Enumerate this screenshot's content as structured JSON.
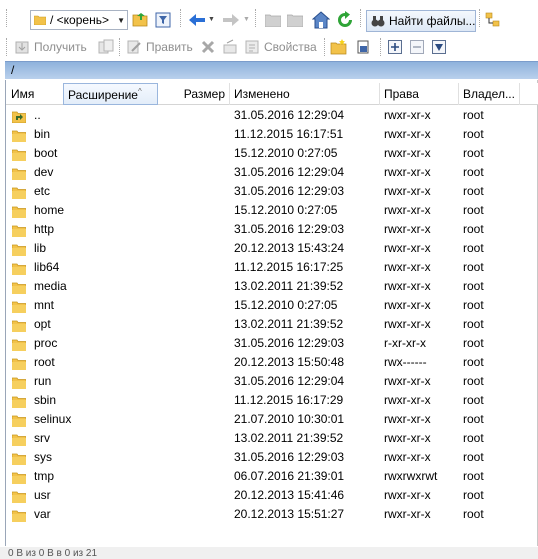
{
  "toolbar": {
    "path_combo_value": "/ <корень>",
    "find_files_label": "Найти файлы..."
  },
  "toolbar2": {
    "get_label": "Получить",
    "edit_label": "Править",
    "properties_label": "Свойства"
  },
  "pathbar": {
    "path": "/"
  },
  "columns": {
    "name": "Имя",
    "extension": "Расширение",
    "size": "Размер",
    "modified": "Изменено",
    "rights": "Права",
    "owner": "Владел..."
  },
  "rows": [
    {
      "name": "..",
      "modified": "31.05.2016 12:29:04",
      "rights": "rwxr-xr-x",
      "owner": "root",
      "icon": "parent-folder-icon"
    },
    {
      "name": "bin",
      "modified": "11.12.2015 16:17:51",
      "rights": "rwxr-xr-x",
      "owner": "root",
      "icon": "folder-icon"
    },
    {
      "name": "boot",
      "modified": "15.12.2010 0:27:05",
      "rights": "rwxr-xr-x",
      "owner": "root",
      "icon": "folder-icon"
    },
    {
      "name": "dev",
      "modified": "31.05.2016 12:29:04",
      "rights": "rwxr-xr-x",
      "owner": "root",
      "icon": "folder-icon"
    },
    {
      "name": "etc",
      "modified": "31.05.2016 12:29:03",
      "rights": "rwxr-xr-x",
      "owner": "root",
      "icon": "folder-icon"
    },
    {
      "name": "home",
      "modified": "15.12.2010 0:27:05",
      "rights": "rwxr-xr-x",
      "owner": "root",
      "icon": "folder-icon"
    },
    {
      "name": "http",
      "modified": "31.05.2016 12:29:03",
      "rights": "rwxr-xr-x",
      "owner": "root",
      "icon": "folder-icon"
    },
    {
      "name": "lib",
      "modified": "20.12.2013 15:43:24",
      "rights": "rwxr-xr-x",
      "owner": "root",
      "icon": "folder-icon"
    },
    {
      "name": "lib64",
      "modified": "11.12.2015 16:17:25",
      "rights": "rwxr-xr-x",
      "owner": "root",
      "icon": "folder-icon"
    },
    {
      "name": "media",
      "modified": "13.02.2011 21:39:52",
      "rights": "rwxr-xr-x",
      "owner": "root",
      "icon": "folder-icon"
    },
    {
      "name": "mnt",
      "modified": "15.12.2010 0:27:05",
      "rights": "rwxr-xr-x",
      "owner": "root",
      "icon": "folder-icon"
    },
    {
      "name": "opt",
      "modified": "13.02.2011 21:39:52",
      "rights": "rwxr-xr-x",
      "owner": "root",
      "icon": "folder-icon"
    },
    {
      "name": "proc",
      "modified": "31.05.2016 12:29:03",
      "rights": "r-xr-xr-x",
      "owner": "root",
      "icon": "folder-icon"
    },
    {
      "name": "root",
      "modified": "20.12.2013 15:50:48",
      "rights": "rwx------",
      "owner": "root",
      "icon": "folder-icon"
    },
    {
      "name": "run",
      "modified": "31.05.2016 12:29:04",
      "rights": "rwxr-xr-x",
      "owner": "root",
      "icon": "folder-icon"
    },
    {
      "name": "sbin",
      "modified": "11.12.2015 16:17:29",
      "rights": "rwxr-xr-x",
      "owner": "root",
      "icon": "folder-icon"
    },
    {
      "name": "selinux",
      "modified": "21.07.2010 10:30:01",
      "rights": "rwxr-xr-x",
      "owner": "root",
      "icon": "folder-icon"
    },
    {
      "name": "srv",
      "modified": "13.02.2011 21:39:52",
      "rights": "rwxr-xr-x",
      "owner": "root",
      "icon": "folder-icon"
    },
    {
      "name": "sys",
      "modified": "31.05.2016 12:29:03",
      "rights": "rwxr-xr-x",
      "owner": "root",
      "icon": "folder-icon"
    },
    {
      "name": "tmp",
      "modified": "06.07.2016 21:39:01",
      "rights": "rwxrwxrwt",
      "owner": "root",
      "icon": "folder-icon"
    },
    {
      "name": "usr",
      "modified": "20.12.2013 15:41:46",
      "rights": "rwxr-xr-x",
      "owner": "root",
      "icon": "folder-icon"
    },
    {
      "name": "var",
      "modified": "20.12.2013 15:51:27",
      "rights": "rwxr-xr-x",
      "owner": "root",
      "icon": "folder-icon"
    }
  ],
  "status": {
    "text": "0 B из 0 B в 0 из 21"
  },
  "colors": {
    "folder": "#f2c24a",
    "pathbar": "#a7c3e6",
    "accent_blue": "#2a6fd6",
    "refresh_green": "#2fa437"
  }
}
